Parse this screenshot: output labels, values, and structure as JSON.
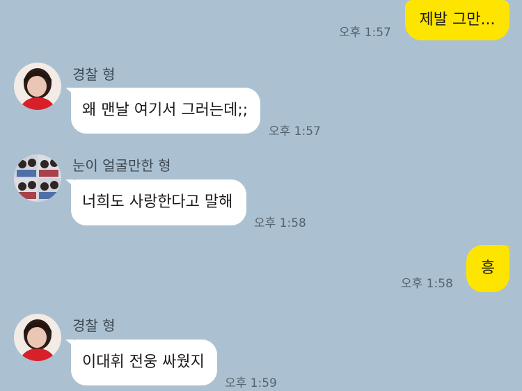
{
  "colors": {
    "background": "#abc1d1",
    "incoming_bubble": "#ffffff",
    "outgoing_bubble": "#fee500",
    "timestamp": "#56636e"
  },
  "messages": [
    {
      "direction": "out",
      "text": "제발 그만...",
      "time": "오후 1:57"
    },
    {
      "direction": "in",
      "sender": "경찰 형",
      "avatar": "red-shirt-avatar-icon",
      "text": "왜 맨날 여기서 그러는데;;",
      "time": "오후 1:57"
    },
    {
      "direction": "in",
      "sender": "눈이 얼굴만한 형",
      "avatar": "group-photo-avatar-icon",
      "text": "너희도 사랑한다고 말해",
      "time": "오후 1:58"
    },
    {
      "direction": "out",
      "text": "흥",
      "time": "오후 1:58"
    },
    {
      "direction": "in",
      "sender": "경찰 형",
      "avatar": "red-shirt-avatar-icon",
      "text": "이대휘 전웅 싸웠지",
      "time": "오후 1:59"
    }
  ]
}
